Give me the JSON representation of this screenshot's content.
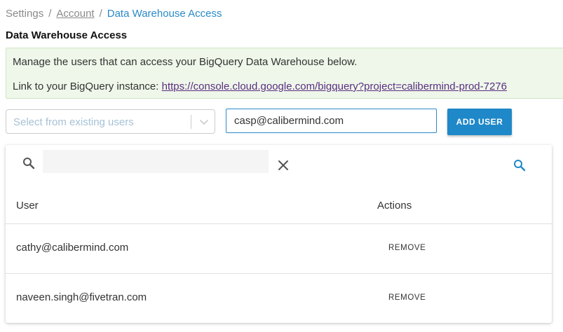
{
  "breadcrumb": {
    "items": [
      {
        "label": "Settings"
      },
      {
        "label": "Account"
      },
      {
        "label": "Data Warehouse Access"
      }
    ],
    "separator": "/"
  },
  "page_title": "Data Warehouse Access",
  "info": {
    "line1": "Manage the users that can access your BigQuery Data Warehouse below.",
    "line2_prefix": "Link to your BigQuery instance: ",
    "link_text": "https://console.cloud.google.com/bigquery?project=calibermind-prod-7276"
  },
  "user_select": {
    "placeholder": "Select from existing users",
    "icon": "chevron-down-icon"
  },
  "email_input": {
    "value": "casp@calibermind.com"
  },
  "add_button": {
    "label": "ADD USER"
  },
  "table": {
    "search": {
      "value": "",
      "icons": [
        "search-icon",
        "close-icon",
        "search-icon"
      ]
    },
    "columns": [
      "User",
      "Actions"
    ],
    "rows": [
      {
        "user": "cathy@calibermind.com",
        "action": "REMOVE"
      },
      {
        "user": "naveen.singh@fivetran.com",
        "action": "REMOVE"
      }
    ]
  },
  "colors": {
    "accent": "#1e88c8",
    "link": "#2a8ac7",
    "info_bg": "#eef7e9",
    "visited_link": "#5a2d82"
  }
}
